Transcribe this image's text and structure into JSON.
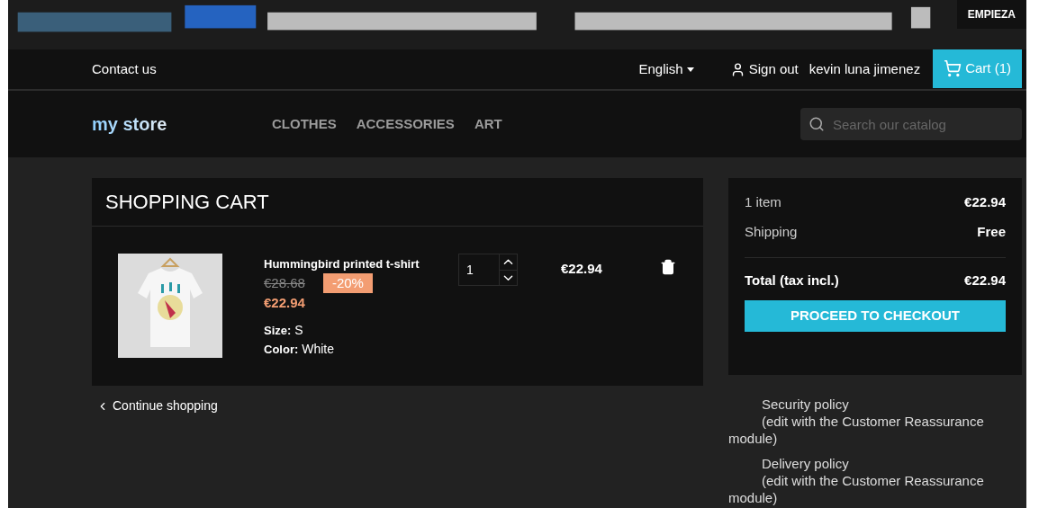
{
  "banner": {
    "kind": "picture",
    "button": "EMPIEZA"
  },
  "topbar": {
    "contact": "Contact us",
    "language": "English",
    "sign_out": "Sign out",
    "user": "kevin luna jimenez",
    "cart": "Cart (1)"
  },
  "header": {
    "logo": "my store",
    "menu": [
      "CLOTHES",
      "ACCESSORIES",
      "ART"
    ],
    "search": {
      "placeholder": "Search our catalog"
    }
  },
  "cart": {
    "title": "SHOPPING CART",
    "items": [
      {
        "name": "Hummingbird printed t-shirt",
        "old_price": "€28.68",
        "discount": "-20%",
        "price": "€22.94",
        "attributes": [
          {
            "label": "Size:",
            "value": "S"
          },
          {
            "label": "Color:",
            "value": "White"
          }
        ],
        "quantity": "1",
        "total": "€22.94"
      }
    ],
    "continue": "Continue shopping"
  },
  "summary": {
    "lines": [
      {
        "label": "1 item",
        "value": "€22.94"
      },
      {
        "label": "Shipping",
        "value": "Free"
      }
    ],
    "total": {
      "label": "Total (tax incl.)",
      "value": "€22.94"
    },
    "checkout": "PROCEED TO CHECKOUT"
  },
  "reassurance": [
    {
      "title": "Security policy",
      "note": "(edit with the Customer Reassurance",
      "note_end": "module)"
    },
    {
      "title": "Delivery policy",
      "note": "(edit with the Customer Reassurance",
      "note_end": "module)"
    }
  ]
}
